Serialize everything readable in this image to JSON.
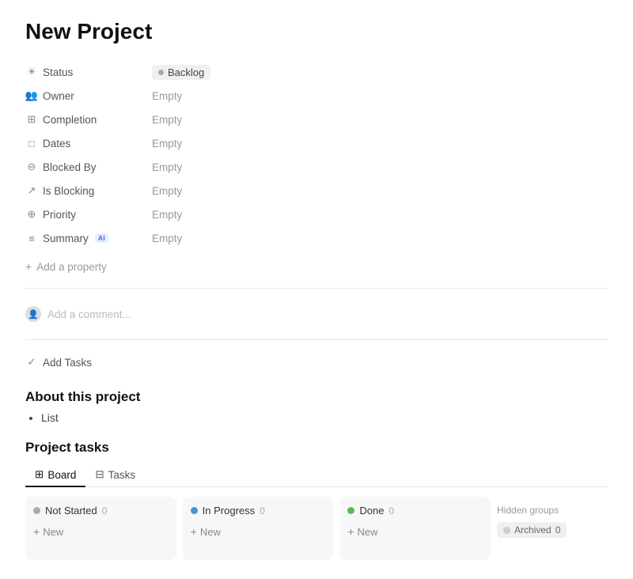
{
  "page": {
    "title": "New Project"
  },
  "properties": [
    {
      "id": "status",
      "icon": "☀",
      "label": "Status",
      "valueType": "badge",
      "badgeText": "Backlog"
    },
    {
      "id": "owner",
      "icon": "👥",
      "label": "Owner",
      "valueType": "text",
      "value": "Empty"
    },
    {
      "id": "completion",
      "icon": "⊞",
      "label": "Completion",
      "valueType": "text",
      "value": "Empty"
    },
    {
      "id": "dates",
      "icon": "□",
      "label": "Dates",
      "valueType": "text",
      "value": "Empty"
    },
    {
      "id": "blocked-by",
      "icon": "⊖",
      "label": "Blocked By",
      "valueType": "text",
      "value": "Empty"
    },
    {
      "id": "is-blocking",
      "icon": "↗",
      "label": "Is Blocking",
      "valueType": "text",
      "value": "Empty"
    },
    {
      "id": "priority",
      "icon": "⊕",
      "label": "Priority",
      "valueType": "text",
      "value": "Empty"
    },
    {
      "id": "summary",
      "icon": "≡",
      "label": "Summary",
      "valueType": "text",
      "value": "Empty",
      "ai": true
    }
  ],
  "addProperty": {
    "label": "Add a property"
  },
  "comment": {
    "placeholder": "Add a comment..."
  },
  "addTasks": {
    "label": "Add Tasks"
  },
  "about": {
    "title": "About this project",
    "listItem": "List"
  },
  "projectTasks": {
    "title": "Project tasks",
    "tabs": [
      {
        "id": "board",
        "label": "Board",
        "active": true
      },
      {
        "id": "tasks",
        "label": "Tasks",
        "active": false
      }
    ],
    "columns": [
      {
        "id": "not-started",
        "label": "Not Started",
        "count": 0,
        "dotClass": "not-started"
      },
      {
        "id": "in-progress",
        "label": "In Progress",
        "count": 0,
        "dotClass": "in-progress"
      },
      {
        "id": "done",
        "label": "Done",
        "count": 0,
        "dotClass": "done"
      }
    ],
    "hiddenGroups": {
      "label": "Hidden groups",
      "archived": {
        "label": "Archived",
        "count": 0
      }
    },
    "newLabel": "New"
  }
}
